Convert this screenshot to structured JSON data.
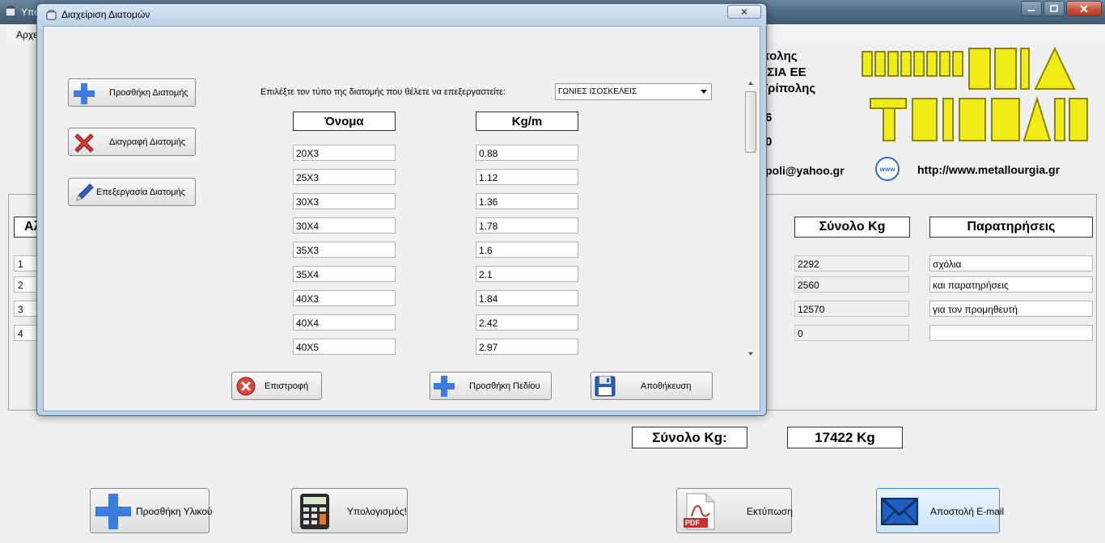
{
  "main_window": {
    "title": "Υπολογισμός Βάρους",
    "menu": {
      "file": "Αρχε"
    },
    "company": {
      "line1": "πολης",
      "line2": "ι ΣΙΑ ΕΕ",
      "line3": "Τρίπολης",
      "line4": "6",
      "line5": "0",
      "email": "poli@yahoo.gr",
      "www_icon_text": "www",
      "website": "http://www.metallourgia.gr"
    },
    "table": {
      "left_header": "Αλ",
      "total_header": "Σύνολο Kg",
      "notes_header": "Παρατηρήσεις",
      "rows": [
        {
          "num": "1",
          "total": "2292",
          "note": "σχόλια"
        },
        {
          "num": "2",
          "total": "2560",
          "note": "και παρατηρήσεις"
        },
        {
          "num": "3",
          "total": "12570",
          "note": "για τον προμηθευτή"
        },
        {
          "num": "4",
          "total": "0",
          "note": ""
        }
      ]
    },
    "sum_label": "Σύνολο Kg:",
    "sum_value": "17422 Kg",
    "buttons": {
      "add_material": "Προσθήκη Υλικού",
      "calculate": "Υπολογισμός!",
      "print": "Εκτύπωση",
      "send_email": "Αποστολή E-mail"
    },
    "pdf_icon_text": "PDF",
    "colors": {
      "accent_blue": "#2a6fd6",
      "logo_yellow": "#f2ec16"
    }
  },
  "dialog": {
    "title": "Διαχείριση Διατομών",
    "close_glyph": "✕",
    "buttons": {
      "add": "Προσθήκη Διατομής",
      "delete": "Διαγραφή Διατομής",
      "edit": "Επεξεργασία Διατομής",
      "back": "Επιστροφή",
      "add_field": "Προσθήκη Πεδίου",
      "save": "Αποθήκευση"
    },
    "type_label": "Επιλέξτε τον τύπο της διατομής που θέλετε να επεξεργαστείτε:",
    "type_selected": "ΓΩΝΙΕΣ ΙΣΟΣΚΕΛΕΙΣ",
    "col_name": "Όνομα",
    "col_kg": "Kg/m",
    "rows": [
      {
        "name": "20X3",
        "kg": "0.88"
      },
      {
        "name": "25X3",
        "kg": "1.12"
      },
      {
        "name": "30X3",
        "kg": "1.36"
      },
      {
        "name": "30X4",
        "kg": "1.78"
      },
      {
        "name": "35X3",
        "kg": "1.6"
      },
      {
        "name": "35X4",
        "kg": "2.1"
      },
      {
        "name": "40X3",
        "kg": "1.84"
      },
      {
        "name": "40X4",
        "kg": "2.42"
      },
      {
        "name": "40X5",
        "kg": "2.97"
      }
    ]
  }
}
